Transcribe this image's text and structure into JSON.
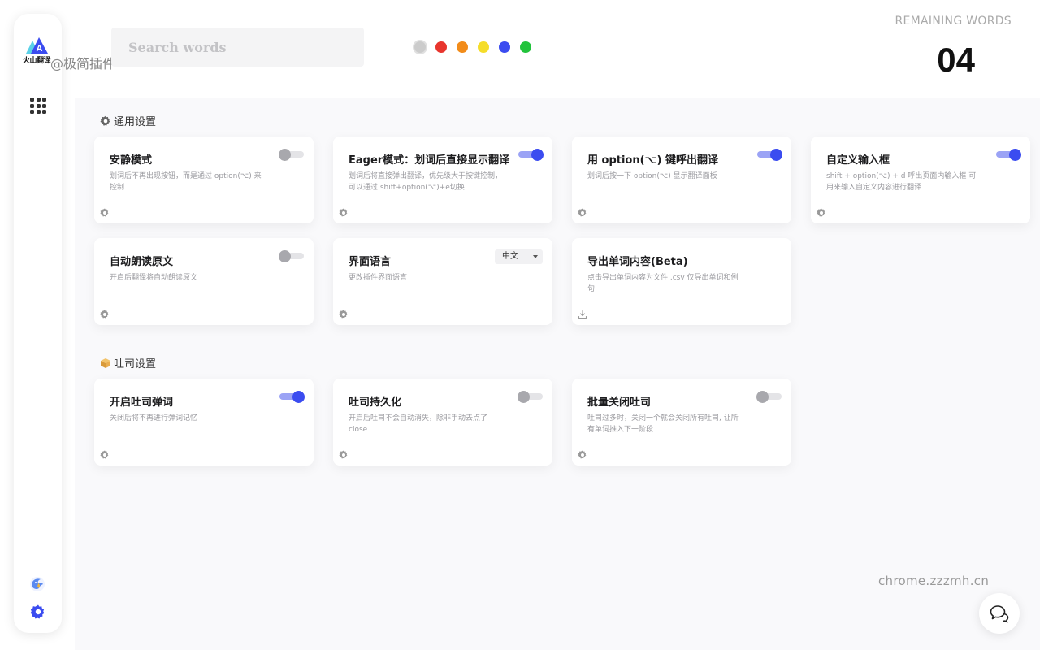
{
  "brand": {
    "logo_text": "火山翻译",
    "watermark": "@极简插件",
    "site_watermark": "chrome.zzzmh.cn"
  },
  "sidebar": {
    "items": [
      {
        "icon": "apps-grid-icon"
      },
      {
        "icon": "bird-icon"
      },
      {
        "icon": "gear-icon"
      }
    ]
  },
  "search": {
    "placeholder": "Search words",
    "value": ""
  },
  "color_filters": [
    {
      "color": "#cccccc",
      "selected": true
    },
    {
      "color": "#e8352d"
    },
    {
      "color": "#f28c1a"
    },
    {
      "color": "#f5dd2a"
    },
    {
      "color": "#3b4cf0"
    },
    {
      "color": "#22c33c"
    }
  ],
  "remaining": {
    "label": "REMAINING WORDS",
    "count": "04"
  },
  "sections": {
    "general": {
      "title": "通用设置",
      "icon": "gear-icon"
    },
    "toast": {
      "title": "吐司设置",
      "icon": "box-icon"
    }
  },
  "cards": {
    "quiet_mode": {
      "title": "安静模式",
      "desc": "划词后不再出现按钮，而是通过 option(⌥) 来控制",
      "on": false
    },
    "eager_mode": {
      "title": "Eager模式：划词后直接显示翻译",
      "desc": "划词后将直接弹出翻译，优先级大于按键控制， 可以通过 shift+option(⌥)+e切换",
      "on": true
    },
    "option_key": {
      "title": "用 option(⌥) 键呼出翻译",
      "desc": "划词后按一下 option(⌥) 显示翻译面板",
      "on": true
    },
    "custom_input": {
      "title": "自定义输入框",
      "desc": "shift + option(⌥) + d 呼出页面内输入框 可用来输入自定义内容进行翻译",
      "on": true
    },
    "auto_read": {
      "title": "自动朗读原文",
      "desc": "开启后翻译将自动朗读原文",
      "on": false
    },
    "ui_language": {
      "title": "界面语言",
      "desc": "更改插件界面语言",
      "selected": "中文"
    },
    "export_words": {
      "title": "导出单词内容(Beta)",
      "desc": "点击导出单词内容为文件 .csv 仅导出单词和例句"
    },
    "toast_popup": {
      "title": "开启吐司弹词",
      "desc": "关闭后将不再进行弹词记忆",
      "on": true
    },
    "toast_persist": {
      "title": "吐司持久化",
      "desc": "开启后吐司不会自动消失，除非手动去点了 close",
      "on": false
    },
    "batch_close": {
      "title": "批量关闭吐司",
      "desc": "吐司过多时，关闭一个就会关闭所有吐司, 让所有单词推入下一阶段",
      "on": false
    }
  },
  "colors": {
    "accent": "#3b4cf0",
    "accent_light": "#9ba3f5",
    "toggle_off": "#a8a8ad"
  }
}
